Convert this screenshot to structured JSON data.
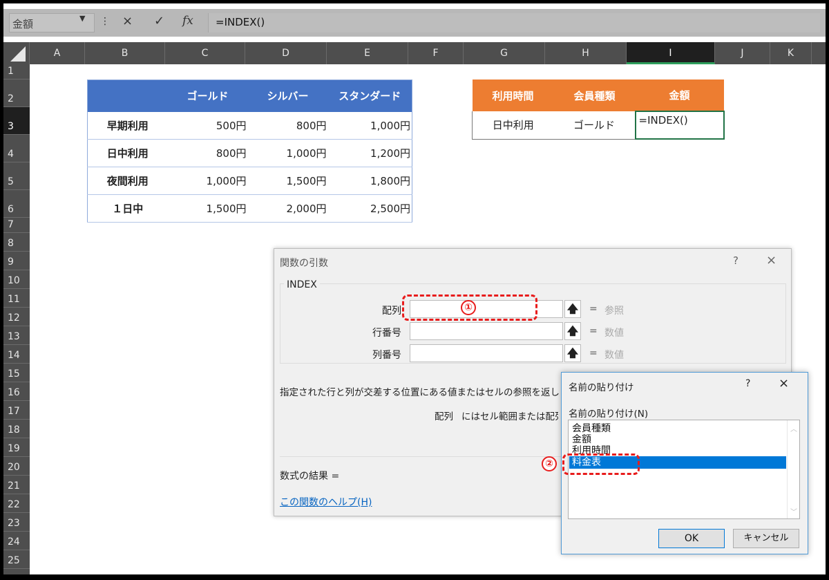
{
  "formula_bar": {
    "name_box": "金額",
    "cancel_icon": "×",
    "enter_icon": "✓",
    "fx_label": "fx",
    "formula": "=INDEX()"
  },
  "columns": [
    "A",
    "B",
    "C",
    "D",
    "E",
    "F",
    "G",
    "H",
    "I",
    "J",
    "K"
  ],
  "selected_column": "I",
  "rows": [
    "1",
    "2",
    "3",
    "4",
    "5",
    "6",
    "7",
    "8",
    "9",
    "10",
    "11",
    "12",
    "13",
    "14",
    "15",
    "16",
    "17",
    "18",
    "19",
    "20",
    "21",
    "22",
    "23",
    "24",
    "25"
  ],
  "selected_row": "3",
  "price_table": {
    "headers": [
      "",
      "ゴールド",
      "シルバー",
      "スタンダード"
    ],
    "rows": [
      {
        "label": "早期利用",
        "values": [
          "500円",
          "800円",
          "1,000円"
        ]
      },
      {
        "label": "日中利用",
        "values": [
          "800円",
          "1,000円",
          "1,200円"
        ]
      },
      {
        "label": "夜間利用",
        "values": [
          "1,000円",
          "1,500円",
          "1,800円"
        ]
      },
      {
        "label": "１日中",
        "values": [
          "1,500円",
          "2,000円",
          "2,500円"
        ]
      }
    ]
  },
  "lookup_table": {
    "headers": [
      "利用時間",
      "会員種類",
      "金額"
    ],
    "row": [
      "日中利用",
      "ゴールド",
      "=INDEX()"
    ]
  },
  "function_args_dialog": {
    "title": "関数の引数",
    "help": "?",
    "close": "×",
    "function_name": "INDEX",
    "args": [
      {
        "label": "配列",
        "value": "",
        "result": "参照"
      },
      {
        "label": "行番号",
        "value": "",
        "result": "数値"
      },
      {
        "label": "列番号",
        "value": "",
        "result": "数値"
      }
    ],
    "equals": "=",
    "ref_button": "🡅",
    "description": "指定された行と列が交差する位置にある値またはセルの参照を返します。",
    "arg_desc_name": "配列",
    "arg_desc_text": "にはセル範囲または配列定",
    "result_label": "数式の結果 =",
    "help_link": "この関数のヘルプ(H)"
  },
  "paste_name_dialog": {
    "title": "名前の貼り付け",
    "help": "?",
    "close": "×",
    "list_label": "名前の貼り付け(N)",
    "items": [
      "会員種類",
      "金額",
      "利用時間",
      "料金表"
    ],
    "selected_item": "料金表",
    "ok": "OK",
    "cancel": "キャンセル"
  },
  "annotations": {
    "step1": "①",
    "step2": "②",
    "color": "#e81c1c"
  }
}
